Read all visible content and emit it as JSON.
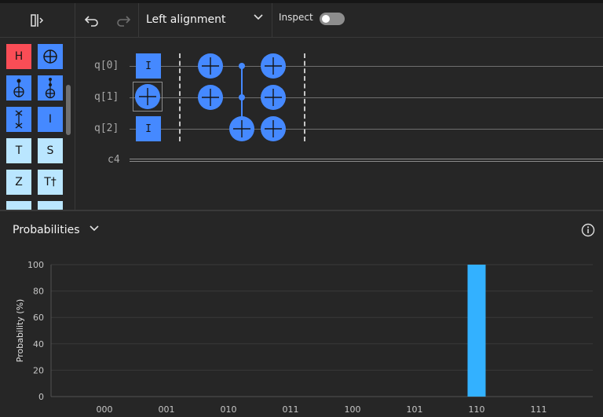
{
  "toolbar": {
    "alignment_label": "Left alignment",
    "inspect_label": "Inspect",
    "inspect_on": false
  },
  "palette": {
    "gates": [
      {
        "label": "H",
        "color": "#fa4d56"
      },
      {
        "label": "",
        "icon": "oplus-icon",
        "color": "#4589ff"
      },
      {
        "label": "",
        "icon": "cnot-icon",
        "color": "#4589ff"
      },
      {
        "label": "",
        "icon": "toffoli-icon",
        "color": "#4589ff"
      },
      {
        "label": "",
        "icon": "swap-icon",
        "color": "#4589ff"
      },
      {
        "label": "I",
        "color": "#4589ff"
      },
      {
        "label": "T",
        "color": "#bae6ff"
      },
      {
        "label": "S",
        "color": "#bae6ff"
      },
      {
        "label": "Z",
        "color": "#bae6ff"
      },
      {
        "label": "T†",
        "color": "#bae6ff"
      }
    ]
  },
  "circuit": {
    "qubits": [
      "q[0]",
      "q[1]",
      "q[2]"
    ],
    "classical": "c4",
    "gate_label_I": "I"
  },
  "panel": {
    "title": "Probabilities"
  },
  "chart_data": {
    "type": "bar",
    "categories": [
      "000",
      "001",
      "010",
      "011",
      "100",
      "101",
      "110",
      "111"
    ],
    "values": [
      0,
      0,
      0,
      0,
      0,
      0,
      100,
      0
    ],
    "ylabel": "Probability (%)",
    "ylim": [
      0,
      100
    ],
    "yticks": [
      "0",
      "20",
      "40",
      "60",
      "80",
      "100"
    ],
    "grid": true,
    "bar_color": "#33b1ff"
  }
}
